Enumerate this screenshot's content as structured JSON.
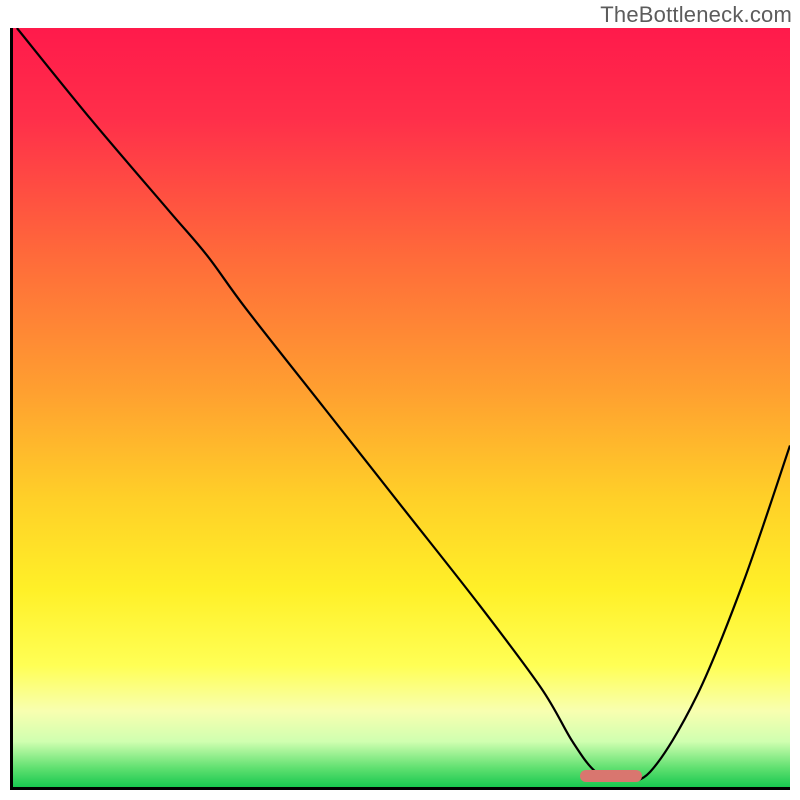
{
  "watermark": "TheBottleneck.com",
  "chart_data": {
    "type": "line",
    "title": "",
    "xlabel": "",
    "ylabel": "",
    "xlim": [
      0,
      100
    ],
    "ylim": [
      0,
      100
    ],
    "grid": false,
    "background_gradient": {
      "stops": [
        {
          "pos": 0.0,
          "color": "#ff1a4b"
        },
        {
          "pos": 0.12,
          "color": "#ff2f4a"
        },
        {
          "pos": 0.3,
          "color": "#ff6a3a"
        },
        {
          "pos": 0.48,
          "color": "#ffa030"
        },
        {
          "pos": 0.62,
          "color": "#ffd028"
        },
        {
          "pos": 0.74,
          "color": "#fff028"
        },
        {
          "pos": 0.84,
          "color": "#ffff55"
        },
        {
          "pos": 0.9,
          "color": "#f8ffb0"
        },
        {
          "pos": 0.94,
          "color": "#d0ffb0"
        },
        {
          "pos": 0.975,
          "color": "#60e070"
        },
        {
          "pos": 1.0,
          "color": "#18c850"
        }
      ]
    },
    "series": [
      {
        "name": "bottleneck-curve",
        "color": "#000000",
        "x": [
          0.5,
          10,
          20,
          25,
          30,
          40,
          50,
          60,
          68,
          72,
          75,
          78,
          82,
          88,
          94,
          100
        ],
        "y": [
          100,
          88,
          76,
          70,
          63,
          50,
          37,
          24,
          13,
          6,
          2,
          1,
          2,
          12,
          27,
          45
        ]
      }
    ],
    "marker": {
      "name": "optimal-range",
      "x_start": 73,
      "x_end": 81,
      "y": 1,
      "color": "#d9766f"
    }
  }
}
